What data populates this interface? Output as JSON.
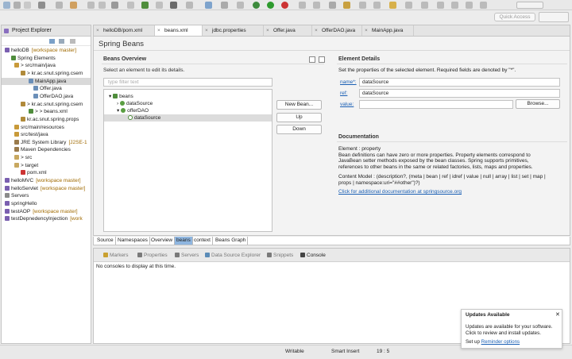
{
  "quick_access": "Quick Access",
  "project_explorer": {
    "title": "Project Explorer",
    "rows": [
      {
        "t": "helloDB",
        "d": "[workspace master]"
      },
      {
        "t": "Spring Elements",
        "d": ""
      },
      {
        "t": "> src/main/java",
        "d": ""
      },
      {
        "t": "> kr.ac.snut.spring.csem",
        "d": ""
      },
      {
        "t": "MainApp.java",
        "d": ""
      },
      {
        "t": "Offer.java",
        "d": ""
      },
      {
        "t": "OfferDAO.java",
        "d": ""
      },
      {
        "t": "> kr.ac.snut.spring.csem",
        "d": ""
      },
      {
        "t": "> > beans.xml",
        "d": ""
      },
      {
        "t": "kr.ac.snut.spring.props",
        "d": ""
      },
      {
        "t": "src/main/resources",
        "d": ""
      },
      {
        "t": "src/test/java",
        "d": ""
      },
      {
        "t": "JRE System Library",
        "d": "[J2SE-1"
      },
      {
        "t": "Maven Dependencies",
        "d": ""
      },
      {
        "t": "> src",
        "d": ""
      },
      {
        "t": "> target",
        "d": ""
      },
      {
        "t": "pom.xml",
        "d": ""
      },
      {
        "t": "helloMVC",
        "d": "[workspace master]"
      },
      {
        "t": "helloServlet",
        "d": "[workspace master]"
      },
      {
        "t": "Servers",
        "d": ""
      },
      {
        "t": "springHello",
        "d": ""
      },
      {
        "t": "testAOP",
        "d": "[workspace master]"
      },
      {
        "t": "testDepnedencyInjection",
        "d": "[work"
      }
    ]
  },
  "editor_tabs": [
    "helloDB/pom.xml",
    "beans.xml",
    "jdbc.properties",
    "Offer.java",
    "OfferDAO.java",
    "MainApp.java"
  ],
  "editor": {
    "title": "Spring Beans",
    "overview_title": "Beans Overview",
    "overview_desc": "Select an element to edit its details.",
    "filter_placeholder": "type filter text",
    "tree": [
      "beans",
      "dataSource",
      "offerDAO",
      "dataSource"
    ],
    "buttons": {
      "new_bean": "New Bean...",
      "up": "Up",
      "down": "Down"
    },
    "details_title": "Element Details",
    "details_desc": "Set the properties of the selected element. Required fields are denoted by \"*\".",
    "name_label": "name*:",
    "name_value": "dataSource",
    "ref_label": "ref:",
    "ref_value": "dataSource",
    "value_label": "value:",
    "value_value": "",
    "browse": "Browse...",
    "doc_title": "Documentation",
    "doc_lines": [
      "Element : property",
      "Bean definitions can have zero or more properties. Property elements correspond to",
      "JavaBean setter methods exposed by the bean classes. Spring supports primitives,",
      "references to other beans in the same or related factories, lists, maps and properties."
    ],
    "content_model_lines": [
      "Content Model : (description?, (meta | bean | ref | idref | value | null | array | list | set | map |",
      "props | namespace:uri=\"##other\")?)"
    ],
    "doc_link": "Click for additional documentation at springsource.org"
  },
  "page_tabs": [
    "Source",
    "Namespaces",
    "Overview",
    "beans",
    "context",
    "Beans Graph"
  ],
  "console": {
    "tabs": [
      "Markers",
      "Properties",
      "Servers",
      "Data Source Explorer",
      "Snippets",
      "Console"
    ],
    "message": "No consoles to display at this time."
  },
  "status": {
    "mode": "Writable",
    "insert": "Smart Insert",
    "pos": "19 : 5"
  },
  "popup": {
    "title": "Updates Available",
    "line1": "Updates are available for your software.",
    "line2": "Click to review and install updates.",
    "setup": "Set up",
    "link": "Reminder options"
  }
}
